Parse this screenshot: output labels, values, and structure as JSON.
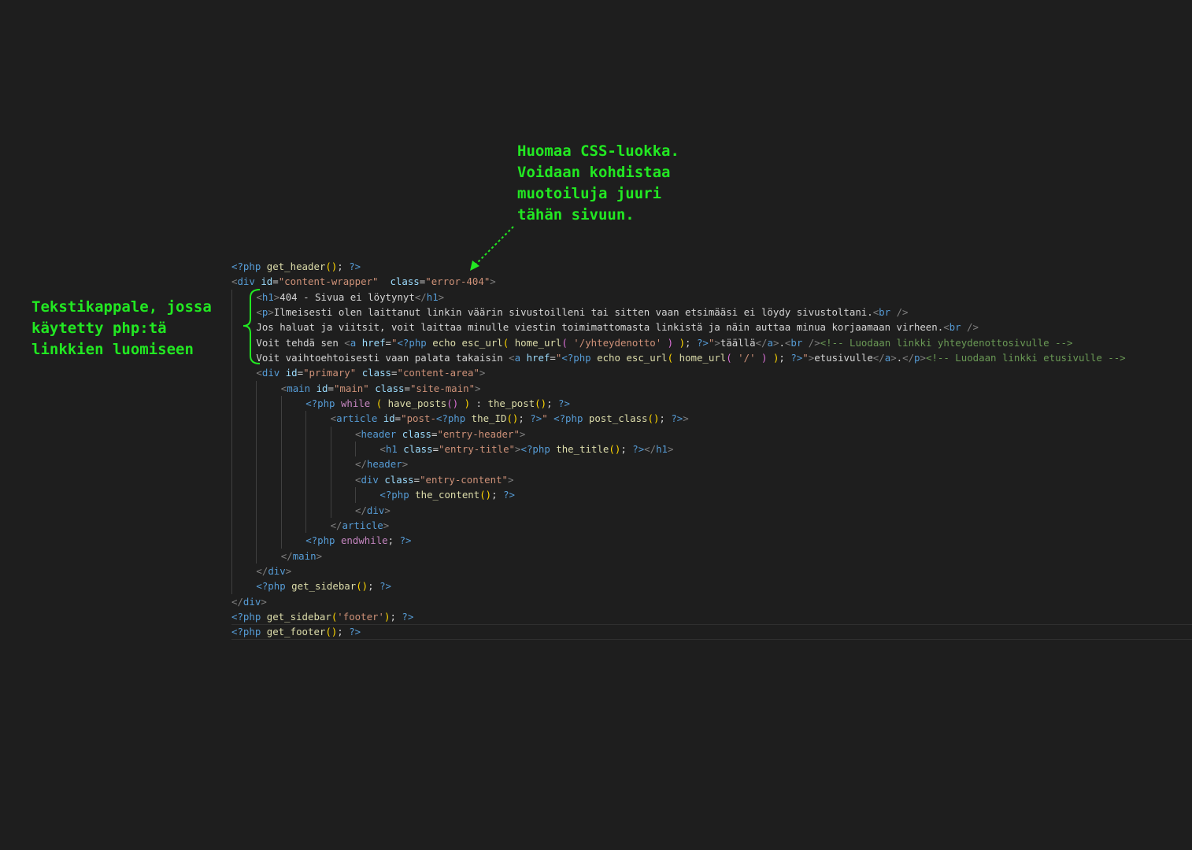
{
  "annotations": {
    "css_note": "Huomaa CSS-luokka.\nVoidaan kohdistaa\nmuotoiluja juuri\ntähän sivuun.",
    "php_note": "Tekstikappale, jossa\nkäytetty php:tä\nlinkkien luomiseen"
  },
  "colors": {
    "background": "#1e1e1e",
    "annotation": "#22e822",
    "php_tag": "#569cd6",
    "function": "#dcdcaa",
    "string": "#ce9178",
    "attribute": "#9cdcfe",
    "keyword": "#c586c0",
    "comment": "#6a9955",
    "text": "#d4d4d4"
  },
  "code_lines": [
    {
      "indent": 0,
      "tokens": [
        [
          "pu",
          "<?php "
        ],
        [
          "fn",
          "get_header"
        ],
        [
          "br",
          "()"
        ],
        [
          "tx",
          "; "
        ],
        [
          "pu",
          "?>"
        ]
      ]
    },
    {
      "indent": 0,
      "tokens": [
        [
          "tb",
          "<"
        ],
        [
          "tg",
          "div "
        ],
        [
          "at",
          "id"
        ],
        [
          "tx",
          "="
        ],
        [
          "st",
          "\"content-wrapper\""
        ],
        [
          "tx",
          "  "
        ],
        [
          "at",
          "class"
        ],
        [
          "tx",
          "="
        ],
        [
          "st",
          "\"error-404\""
        ],
        [
          "tb",
          ">"
        ]
      ]
    },
    {
      "indent": 1,
      "tokens": [
        [
          "tb",
          "<"
        ],
        [
          "tg",
          "h1"
        ],
        [
          "tb",
          ">"
        ],
        [
          "tx",
          "404 - Sivua ei löytynyt"
        ],
        [
          "tb",
          "</"
        ],
        [
          "tg",
          "h1"
        ],
        [
          "tb",
          ">"
        ]
      ]
    },
    {
      "indent": 1,
      "tokens": [
        [
          "tb",
          "<"
        ],
        [
          "tg",
          "p"
        ],
        [
          "tb",
          ">"
        ],
        [
          "tx",
          "Ilmeisesti olen laittanut linkin väärin sivustoilleni tai sitten vaan etsimääsi ei löydy sivustoltani."
        ],
        [
          "tb",
          "<"
        ],
        [
          "tg",
          "br "
        ],
        [
          "tb",
          "/>"
        ]
      ]
    },
    {
      "indent": 1,
      "tokens": [
        [
          "tx",
          "Jos haluat ja viitsit, voit laittaa minulle viestin toimimattomasta linkistä ja näin auttaa minua korjaamaan virheen."
        ],
        [
          "tb",
          "<"
        ],
        [
          "tg",
          "br "
        ],
        [
          "tb",
          "/>"
        ]
      ]
    },
    {
      "indent": 1,
      "tokens": [
        [
          "tx",
          "Voit tehdä sen "
        ],
        [
          "tb",
          "<"
        ],
        [
          "tg",
          "a "
        ],
        [
          "at",
          "href"
        ],
        [
          "tx",
          "="
        ],
        [
          "st",
          "\""
        ],
        [
          "pu",
          "<?php "
        ],
        [
          "fn",
          "echo esc_url"
        ],
        [
          "br",
          "( "
        ],
        [
          "fn",
          "home_url"
        ],
        [
          "bv",
          "( "
        ],
        [
          "st",
          "'/yhteydenotto' "
        ],
        [
          "bv",
          ")"
        ],
        [
          "br",
          " )"
        ],
        [
          "tx",
          "; "
        ],
        [
          "pu",
          "?>"
        ],
        [
          "st",
          "\""
        ],
        [
          "tb",
          ">"
        ],
        [
          "tx",
          "täällä"
        ],
        [
          "tb",
          "</"
        ],
        [
          "tg",
          "a"
        ],
        [
          "tb",
          ">"
        ],
        [
          "tx",
          "."
        ],
        [
          "tb",
          "<"
        ],
        [
          "tg",
          "br "
        ],
        [
          "tb",
          "/>"
        ],
        [
          "cm",
          "<!-- Luodaan linkki yhteydenottosivulle -->"
        ]
      ]
    },
    {
      "indent": 1,
      "tokens": [
        [
          "tx",
          "Voit vaihtoehtoisesti vaan palata takaisin "
        ],
        [
          "tb",
          "<"
        ],
        [
          "tg",
          "a "
        ],
        [
          "at",
          "href"
        ],
        [
          "tx",
          "="
        ],
        [
          "st",
          "\""
        ],
        [
          "pu",
          "<?php "
        ],
        [
          "fn",
          "echo esc_url"
        ],
        [
          "br",
          "( "
        ],
        [
          "fn",
          "home_url"
        ],
        [
          "bv",
          "( "
        ],
        [
          "st",
          "'/' "
        ],
        [
          "bv",
          ")"
        ],
        [
          "br",
          " )"
        ],
        [
          "tx",
          "; "
        ],
        [
          "pu",
          "?>"
        ],
        [
          "st",
          "\""
        ],
        [
          "tb",
          ">"
        ],
        [
          "tx",
          "etusivulle"
        ],
        [
          "tb",
          "</"
        ],
        [
          "tg",
          "a"
        ],
        [
          "tb",
          ">"
        ],
        [
          "tx",
          "."
        ],
        [
          "tb",
          "</"
        ],
        [
          "tg",
          "p"
        ],
        [
          "tb",
          ">"
        ],
        [
          "cm",
          "<!-- Luodaan linkki etusivulle -->"
        ]
      ]
    },
    {
      "indent": 1,
      "tokens": [
        [
          "tb",
          "<"
        ],
        [
          "tg",
          "div "
        ],
        [
          "at",
          "id"
        ],
        [
          "tx",
          "="
        ],
        [
          "st",
          "\"primary\" "
        ],
        [
          "at",
          "class"
        ],
        [
          "tx",
          "="
        ],
        [
          "st",
          "\"content-area\""
        ],
        [
          "tb",
          ">"
        ]
      ]
    },
    {
      "indent": 2,
      "tokens": [
        [
          "tb",
          "<"
        ],
        [
          "tg",
          "main "
        ],
        [
          "at",
          "id"
        ],
        [
          "tx",
          "="
        ],
        [
          "st",
          "\"main\" "
        ],
        [
          "at",
          "class"
        ],
        [
          "tx",
          "="
        ],
        [
          "st",
          "\"site-main\""
        ],
        [
          "tb",
          ">"
        ]
      ]
    },
    {
      "indent": 3,
      "tokens": [
        [
          "pu",
          "<?php "
        ],
        [
          "kw",
          "while "
        ],
        [
          "br",
          "( "
        ],
        [
          "fn",
          "have_posts"
        ],
        [
          "bv",
          "()"
        ],
        [
          "br",
          " )"
        ],
        [
          "tx",
          " : "
        ],
        [
          "fn",
          "the_post"
        ],
        [
          "br",
          "()"
        ],
        [
          "tx",
          "; "
        ],
        [
          "pu",
          "?>"
        ]
      ]
    },
    {
      "indent": 4,
      "tokens": [
        [
          "tb",
          "<"
        ],
        [
          "tg",
          "article "
        ],
        [
          "at",
          "id"
        ],
        [
          "tx",
          "="
        ],
        [
          "st",
          "\"post-"
        ],
        [
          "pu",
          "<?php "
        ],
        [
          "fn",
          "the_ID"
        ],
        [
          "br",
          "()"
        ],
        [
          "tx",
          "; "
        ],
        [
          "pu",
          "?>"
        ],
        [
          "st",
          "\" "
        ],
        [
          "pu",
          "<?php "
        ],
        [
          "fn",
          "post_class"
        ],
        [
          "br",
          "()"
        ],
        [
          "tx",
          "; "
        ],
        [
          "pu",
          "?>"
        ],
        [
          "tb",
          ">"
        ]
      ]
    },
    {
      "indent": 5,
      "tokens": [
        [
          "tb",
          "<"
        ],
        [
          "tg",
          "header "
        ],
        [
          "at",
          "class"
        ],
        [
          "tx",
          "="
        ],
        [
          "st",
          "\"entry-header\""
        ],
        [
          "tb",
          ">"
        ]
      ]
    },
    {
      "indent": 6,
      "tokens": [
        [
          "tb",
          "<"
        ],
        [
          "tg",
          "h1 "
        ],
        [
          "at",
          "class"
        ],
        [
          "tx",
          "="
        ],
        [
          "st",
          "\"entry-title\""
        ],
        [
          "tb",
          ">"
        ],
        [
          "pu",
          "<?php "
        ],
        [
          "fn",
          "the_title"
        ],
        [
          "br",
          "()"
        ],
        [
          "tx",
          "; "
        ],
        [
          "pu",
          "?>"
        ],
        [
          "tb",
          "</"
        ],
        [
          "tg",
          "h1"
        ],
        [
          "tb",
          ">"
        ]
      ]
    },
    {
      "indent": 5,
      "tokens": [
        [
          "tb",
          "</"
        ],
        [
          "tg",
          "header"
        ],
        [
          "tb",
          ">"
        ]
      ]
    },
    {
      "indent": 5,
      "tokens": [
        [
          "tb",
          "<"
        ],
        [
          "tg",
          "div "
        ],
        [
          "at",
          "class"
        ],
        [
          "tx",
          "="
        ],
        [
          "st",
          "\"entry-content\""
        ],
        [
          "tb",
          ">"
        ]
      ]
    },
    {
      "indent": 6,
      "tokens": [
        [
          "pu",
          "<?php "
        ],
        [
          "fn",
          "the_content"
        ],
        [
          "br",
          "()"
        ],
        [
          "tx",
          "; "
        ],
        [
          "pu",
          "?>"
        ]
      ]
    },
    {
      "indent": 5,
      "tokens": [
        [
          "tb",
          "</"
        ],
        [
          "tg",
          "div"
        ],
        [
          "tb",
          ">"
        ]
      ]
    },
    {
      "indent": 4,
      "tokens": [
        [
          "tb",
          "</"
        ],
        [
          "tg",
          "article"
        ],
        [
          "tb",
          ">"
        ]
      ]
    },
    {
      "indent": 3,
      "tokens": [
        [
          "pu",
          "<?php "
        ],
        [
          "kw",
          "endwhile"
        ],
        [
          "tx",
          "; "
        ],
        [
          "pu",
          "?>"
        ]
      ]
    },
    {
      "indent": 2,
      "tokens": [
        [
          "tb",
          "</"
        ],
        [
          "tg",
          "main"
        ],
        [
          "tb",
          ">"
        ]
      ]
    },
    {
      "indent": 1,
      "tokens": [
        [
          "tb",
          "</"
        ],
        [
          "tg",
          "div"
        ],
        [
          "tb",
          ">"
        ]
      ]
    },
    {
      "indent": 1,
      "tokens": [
        [
          "pu",
          "<?php "
        ],
        [
          "fn",
          "get_sidebar"
        ],
        [
          "br",
          "()"
        ],
        [
          "tx",
          "; "
        ],
        [
          "pu",
          "?>"
        ]
      ]
    },
    {
      "indent": 0,
      "tokens": [
        [
          "tb",
          "</"
        ],
        [
          "tg",
          "div"
        ],
        [
          "tb",
          ">"
        ]
      ]
    },
    {
      "indent": 0,
      "tokens": [
        [
          "pu",
          "<?php "
        ],
        [
          "fn",
          "get_sidebar"
        ],
        [
          "br",
          "("
        ],
        [
          "st",
          "'footer'"
        ],
        [
          "br",
          ")"
        ],
        [
          "tx",
          "; "
        ],
        [
          "pu",
          "?>"
        ]
      ]
    },
    {
      "indent": 0,
      "current": true,
      "tokens": [
        [
          "pu",
          "<?php "
        ],
        [
          "fn",
          "get_footer"
        ],
        [
          "br",
          "()"
        ],
        [
          "tx",
          "; "
        ],
        [
          "pu",
          "?>"
        ]
      ]
    }
  ]
}
